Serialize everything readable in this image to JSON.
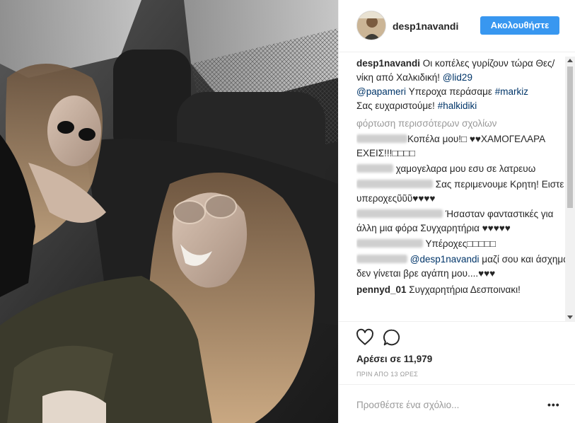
{
  "post": {
    "username": "desp1navandi",
    "follow_label": "Ακολουθήστε",
    "caption": {
      "username": "desp1navandi",
      "text_1": " Οι κοπέλες γυρίζουν τώρα Θες/νίκη από Χαλκιδική! ",
      "mention_1": "@lid29",
      "mention_2": "@papameri",
      "text_2": " Υπεροχα περάσαμε ",
      "hashtag_1": "#markiz",
      "text_3": "Σας ευχαριστούμε! ",
      "hashtag_2": "#halkidiki"
    },
    "load_more": "φόρτωση περισσότερων σχολίων",
    "comments": [
      {
        "text": "Κοπέλα μου!□ ♥♥ΧΑΜΟΓΕΛΑΡΑ ΕΧΕΙΣ!!!□□□□"
      },
      {
        "text": " χαμογελαρα μου εσυ σε λατρευω"
      },
      {
        "text": " Σας περιμενουμε Κρητη! Ειστε υπεροχεςῦῦῦ♥♥♥♥"
      },
      {
        "text": " Ήσασταν φανταστικές για άλλη μια φόρα Συγχαρητήρια ♥♥♥♥♥"
      },
      {
        "text": " Υπέροχες□□□□□"
      },
      {
        "mention": "@desp1navandi",
        "text": " μαζί σου και άσχημα δεν γίνεται βρε αγάπη μου....♥♥♥"
      },
      {
        "username": "pennyd_01",
        "text": " Συγχαρητήρια Δεσποινακι!"
      }
    ],
    "likes": "Αρέσει σε 11,979",
    "time": "ΠΡΙΝ ΑΠΟ 13 ΩΡΕΣ",
    "add_comment_placeholder": "Προσθέστε ένα σχόλιο..."
  },
  "icons": {
    "like": "heart-icon",
    "comment": "comment-icon",
    "more": "more-options-icon",
    "avatar": "avatar"
  },
  "colors": {
    "follow_button": "#3897f0",
    "link": "#003569",
    "muted": "#999999",
    "text": "#262626"
  }
}
